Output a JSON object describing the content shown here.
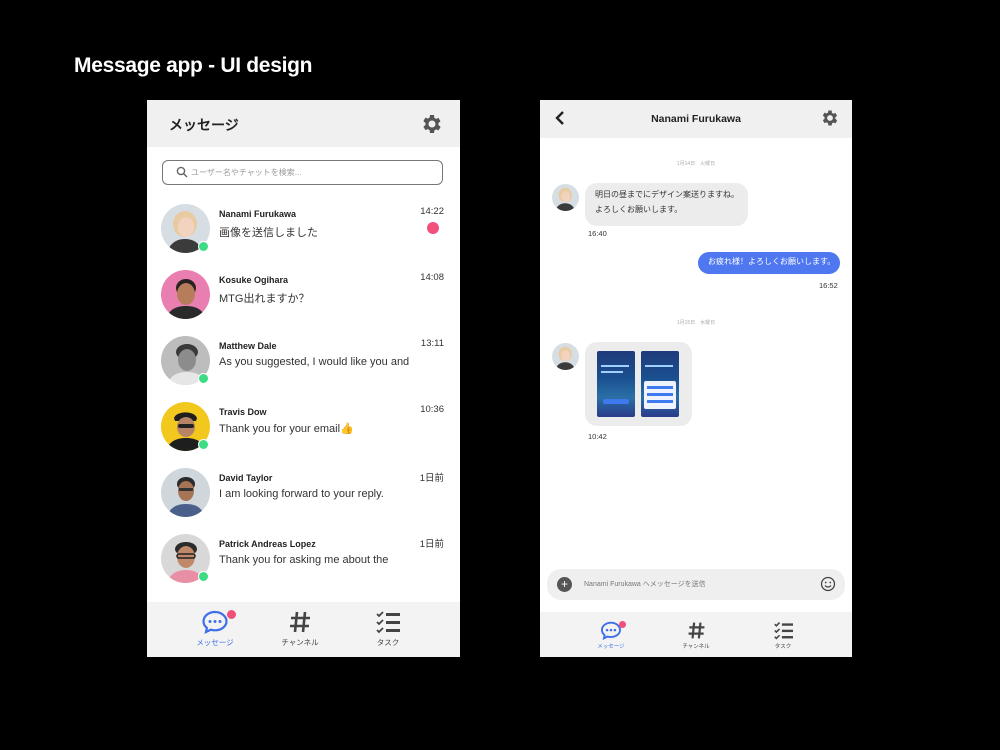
{
  "page_title": "Message app - UI design",
  "list_screen": {
    "header_title": "メッセージ",
    "search_placeholder": "ユーザー名やチャットを検索...",
    "conversations": [
      {
        "name": "Nanami Furukawa",
        "preview": "画像を送信しました",
        "time": "14:22",
        "online": true,
        "unread": true
      },
      {
        "name": "Kosuke Ogihara",
        "preview": "MTG出れますか？",
        "time": "14:08",
        "online": false,
        "unread": false
      },
      {
        "name": "Matthew Dale",
        "preview": "As you suggested, I would like you and",
        "time": "13:11",
        "online": true,
        "unread": false
      },
      {
        "name": "Travis Dow",
        "preview": "Thank you for your email👍",
        "time": "10:36",
        "online": true,
        "unread": false
      },
      {
        "name": "David Taylor",
        "preview": "I am looking forward to your reply.",
        "time": "1日前",
        "online": false,
        "unread": false
      },
      {
        "name": "Patrick Andreas Lopez",
        "preview": "Thank you for asking me about the",
        "time": "1日前",
        "online": true,
        "unread": false
      }
    ],
    "tabs": [
      {
        "label": "メッセージ",
        "icon": "chat-bubble-icon",
        "active": true,
        "badge": true
      },
      {
        "label": "チャンネル",
        "icon": "hashtag-icon",
        "active": false,
        "badge": false
      },
      {
        "label": "タスク",
        "icon": "checklist-icon",
        "active": false,
        "badge": false
      }
    ]
  },
  "chat_screen": {
    "header_title": "Nanami Furukawa",
    "date_separator_1": "1月14日　火曜日",
    "incoming_1_line1": "明日の昼までにデザイン案送りますね。",
    "incoming_1_line2": "よろしくお願いします。",
    "incoming_1_time": "16:40",
    "outgoing_1": "お疲れ様！よろしくお願いします。",
    "outgoing_1_time": "16:52",
    "date_separator_2": "1月15日　水曜日",
    "image_message_time": "10:42",
    "composer_placeholder": "Nanami Furukawa へメッセージを送信",
    "tabs": [
      {
        "label": "メッセージ",
        "icon": "chat-bubble-icon",
        "active": true,
        "badge": true
      },
      {
        "label": "チャンネル",
        "icon": "hashtag-icon",
        "active": false,
        "badge": false
      },
      {
        "label": "タスク",
        "icon": "checklist-icon",
        "active": false,
        "badge": false
      }
    ]
  },
  "colors": {
    "background": "#000000",
    "accent_blue": "#4f78f0",
    "unread_pink": "#f0507a",
    "online_green": "#3ddc84",
    "header_gray": "#f0f0f0"
  }
}
